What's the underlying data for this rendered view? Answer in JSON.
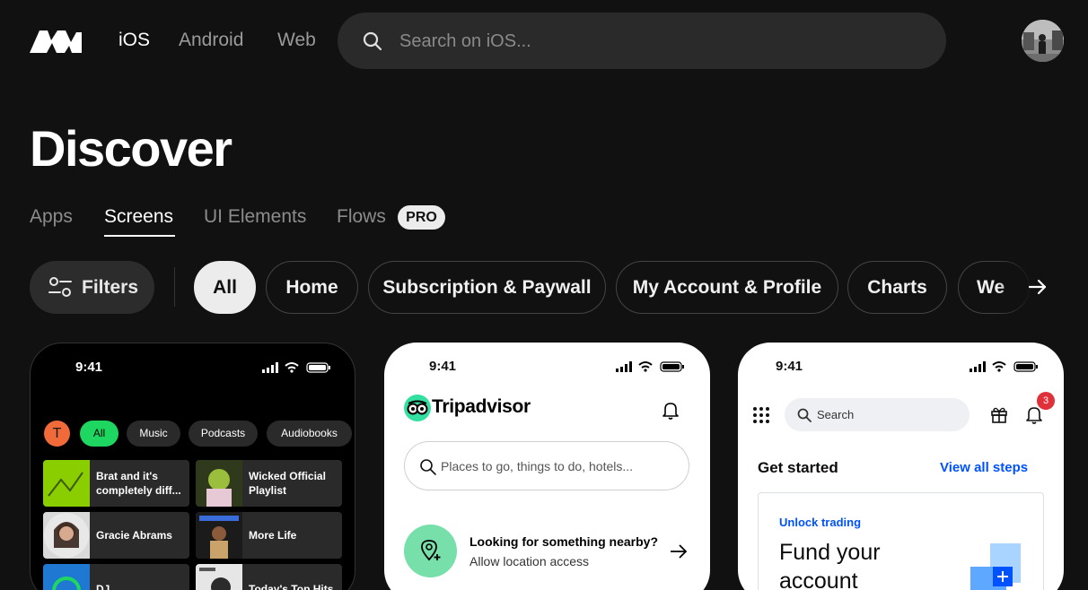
{
  "header": {
    "platforms": [
      "iOS",
      "Android",
      "Web"
    ],
    "active_platform": "iOS",
    "search_placeholder": "Search on iOS..."
  },
  "page": {
    "title": "Discover",
    "tabs": [
      "Apps",
      "Screens",
      "UI Elements",
      "Flows"
    ],
    "active_tab": "Screens",
    "pro_badge": "PRO"
  },
  "filters": {
    "button_label": "Filters",
    "chips": [
      "All",
      "Home",
      "Subscription & Paywall",
      "My Account & Profile",
      "Charts",
      "We"
    ],
    "active_chip": "All"
  },
  "cards": {
    "spotify": {
      "time": "9:41",
      "avatar_letter": "T",
      "chips": [
        "All",
        "Music",
        "Podcasts",
        "Audiobooks"
      ],
      "tiles": [
        "Brat and it's completely diff...",
        "Wicked Official Playlist",
        "Gracie Abrams",
        "More Life",
        "DJ",
        "Today's Top Hits"
      ]
    },
    "tripadvisor": {
      "time": "9:41",
      "brand": "Tripadvisor",
      "search_placeholder": "Places to go, things to do, hotels...",
      "nearby_title": "Looking for something nearby?",
      "nearby_sub": "Allow location access"
    },
    "coinbase": {
      "time": "9:41",
      "search_placeholder": "Search",
      "notification_count": "3",
      "section_title": "Get started",
      "section_link": "View all steps",
      "panel_eyebrow": "Unlock trading",
      "panel_title": "Fund your account"
    }
  },
  "colors": {
    "background": "#111111",
    "spotify_green": "#1ed760",
    "tripadvisor_green": "#34e0a1",
    "coinbase_blue": "#0052ff"
  }
}
